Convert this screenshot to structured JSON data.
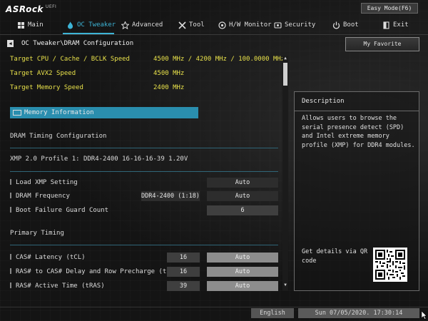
{
  "brand": {
    "logo": "ASRock",
    "suffix": "UEFI"
  },
  "easy_mode": "Easy Mode(F6)",
  "nav": [
    {
      "label": "Main",
      "icon": "main-icon"
    },
    {
      "label": "OC Tweaker",
      "icon": "flame-icon",
      "active": true
    },
    {
      "label": "Advanced",
      "icon": "star-icon"
    },
    {
      "label": "Tool",
      "icon": "tools-icon"
    },
    {
      "label": "H/W Monitor",
      "icon": "monitor-icon"
    },
    {
      "label": "Security",
      "icon": "shield-icon"
    },
    {
      "label": "Boot",
      "icon": "power-icon"
    },
    {
      "label": "Exit",
      "icon": "exit-icon"
    }
  ],
  "breadcrumb": "OC Tweaker\\DRAM Configuration",
  "favorite": "My Favorite",
  "targets": [
    {
      "label": "Target CPU / Cache / BCLK Speed",
      "value": "4500 MHz / 4200 MHz / 100.0000 MHz"
    },
    {
      "label": "Target AVX2 Speed",
      "value": "4500 MHz"
    },
    {
      "label": "Target Memory Speed",
      "value": "2400 MHz"
    }
  ],
  "memory_info": "Memory Information",
  "dram_timing_config": "DRAM Timing Configuration",
  "xmp_profile": "XMP 2.0 Profile 1: DDR4-2400 16-16-16-39 1.20V",
  "settings": {
    "load_xmp": {
      "label": "Load XMP Setting",
      "value": "Auto"
    },
    "dram_freq": {
      "label": "DRAM Frequency",
      "current": "DDR4-2400 (1:18)",
      "value": "Auto"
    },
    "boot_failure": {
      "label": "Boot Failure Guard Count",
      "value": "6"
    }
  },
  "primary_timing": "Primary Timing",
  "timings": [
    {
      "label": "CAS# Latency (tCL)",
      "current": "16",
      "value": "Auto"
    },
    {
      "label": "RAS# to CAS# Delay and Row Precharge (tRCDtRP)",
      "current": "16",
      "value": "Auto"
    },
    {
      "label": "RAS# Active Time (tRAS)",
      "current": "39",
      "value": "Auto"
    }
  ],
  "description": {
    "title": "Description",
    "text": "Allows users to browse the serial presence detect (SPD) and Intel extreme memory profile (XMP) for DDR4 modules.",
    "qr_text": "Get details via QR code"
  },
  "footer": {
    "language": "English",
    "datetime": "Sun 07/05/2020. 17:30:14"
  }
}
